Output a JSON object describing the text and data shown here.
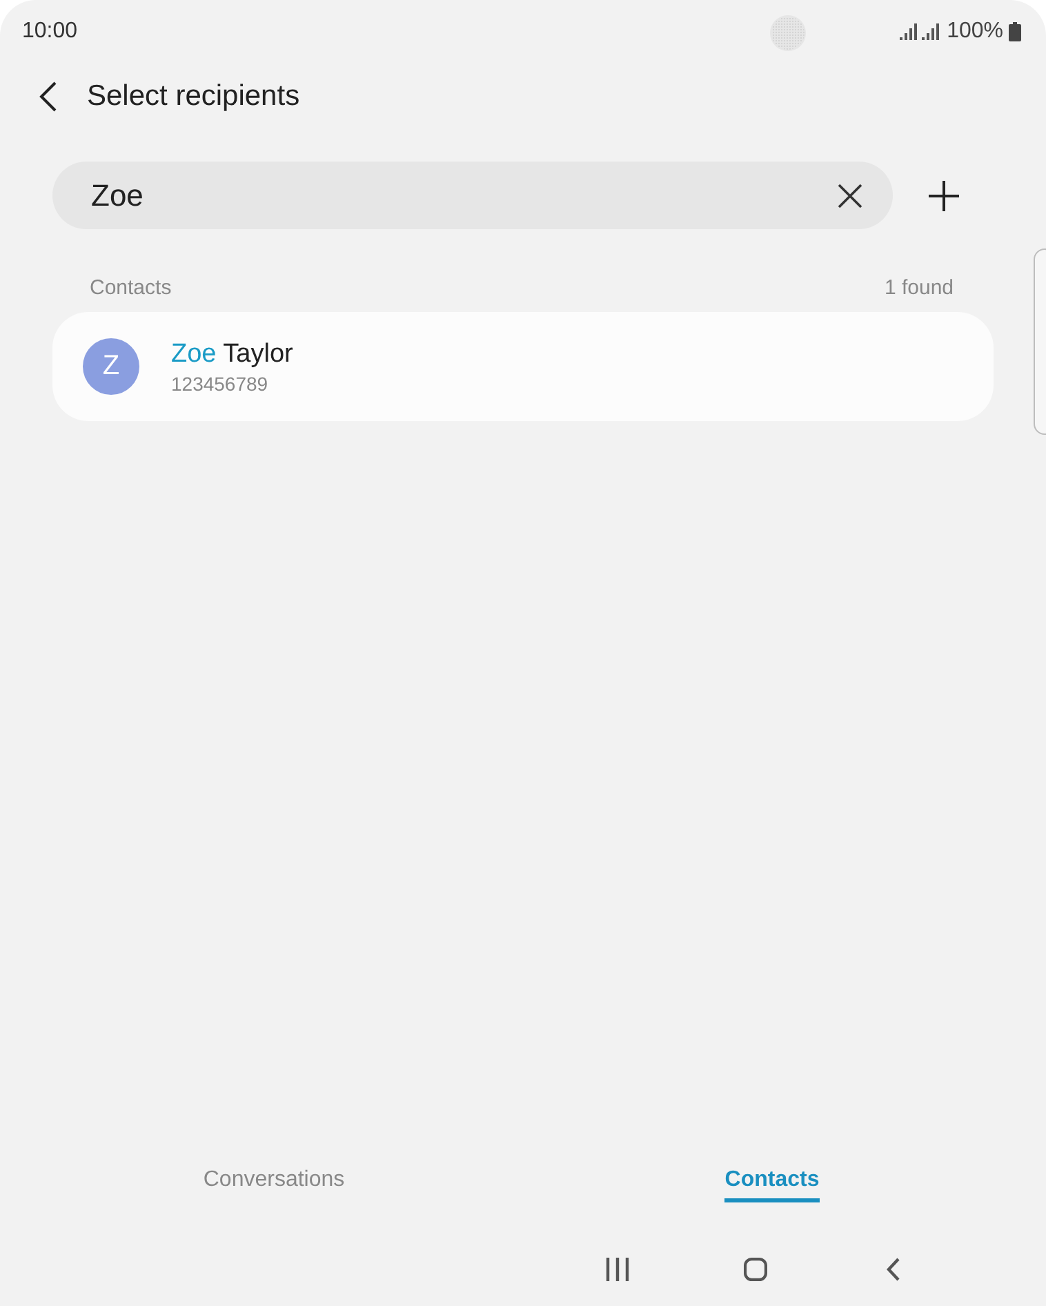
{
  "status_bar": {
    "time": "10:00",
    "battery": "100%"
  },
  "header": {
    "title": "Select recipients"
  },
  "search": {
    "value": "Zoe"
  },
  "results": {
    "section": "Contacts",
    "count": "1 found",
    "contacts": [
      {
        "initial": "Z",
        "name_match": "Zoe",
        "name_rest": "Taylor",
        "number": "123456789",
        "color": "#8a9ee0"
      }
    ]
  },
  "tabs": [
    {
      "label": "Conversations",
      "selected": false
    },
    {
      "label": "Contacts",
      "selected": true
    }
  ]
}
